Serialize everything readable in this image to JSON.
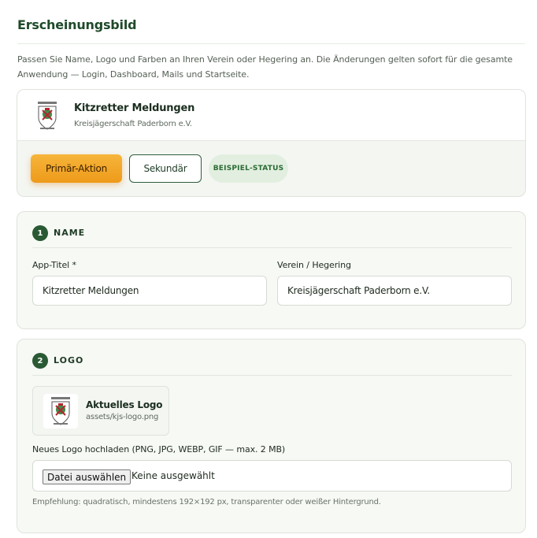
{
  "page": {
    "title": "Erscheinungsbild",
    "intro": "Passen Sie Name, Logo und Farben an Ihren Verein oder Hegering an. Die Änderungen gelten sofort für die gesamte Anwendung — Login, Dashboard, Mails und Startseite."
  },
  "preview": {
    "app_name": "Kitzretter Meldungen",
    "org_name": "Kreisjägerschaft Paderborn e.V.",
    "primary_label": "Primär-Aktion",
    "secondary_label": "Sekundär",
    "status_label": "BEISPIEL-STATUS",
    "logo_icon": "crest-logo-icon"
  },
  "colors": {
    "brand_green": "#2a5a34",
    "accent_orange": "#f0a020",
    "status_bg": "#e2efe0"
  },
  "sections": {
    "name": {
      "number": "1",
      "title": "NAME",
      "app_title_label": "App-Titel *",
      "app_title_value": "Kitzretter Meldungen",
      "org_label": "Verein / Hegering",
      "org_value": "Kreisjägerschaft Paderborn e.V."
    },
    "logo": {
      "number": "2",
      "title": "LOGO",
      "current_title": "Aktuelles Logo",
      "current_path": "assets/kjs-logo.png",
      "upload_label": "Neues Logo hochladen (PNG, JPG, WEBP, GIF — max. 2 MB)",
      "file_button_label": "Datei auswählen",
      "file_status": "Keine ausgewählt",
      "hint": "Empfehlung: quadratisch, mindestens 192×192 px, transparenter oder weißer Hintergrund."
    }
  }
}
